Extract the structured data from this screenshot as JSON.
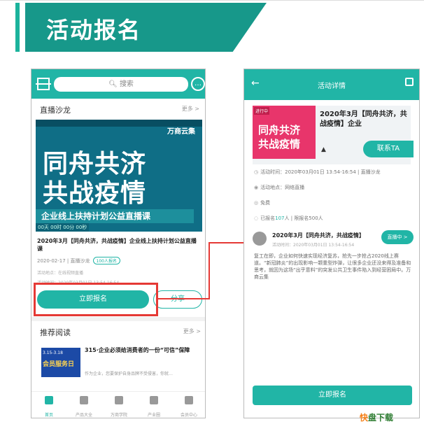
{
  "heading": "活动报名",
  "phone1": {
    "search_placeholder": "搜索",
    "section_live": {
      "title": "直播沙龙",
      "more": "更多 >"
    },
    "banner": {
      "logo": "万商云集",
      "line1": "同舟共济",
      "line2": "共战疫情",
      "tagline": "企业线上扶持计划公益直播课",
      "time": "00天 00时 00分 00秒"
    },
    "event_title": "2020年3月【同舟共济，共战疫情】企业线上扶持计划公益直播课",
    "meta_date": "2020-02-17 | 直播沙龙",
    "meta_tag": "100人报名",
    "meta_location": "活动地点：在线视频直播",
    "meta_time": "活动时间：2020年03月01日 13:54-16:54",
    "signup_label": "立即报名",
    "share_label": "分享",
    "section_reading": {
      "title": "推荐阅读",
      "more": "更多 >"
    },
    "article": {
      "thumb_top": "3.15-3.18",
      "thumb_main": "会员服务日",
      "title": "315·企业必须给消费者的一份“可信”保障",
      "sub": "作为企业，您要保护自身品牌不受侵害，你就…"
    },
    "tabs": [
      {
        "label": "首页",
        "active": true
      },
      {
        "label": "产品大全",
        "active": false
      },
      {
        "label": "万商学院",
        "active": false
      },
      {
        "label": "产业圈",
        "active": false
      },
      {
        "label": "会员中心",
        "active": false
      }
    ]
  },
  "phone2": {
    "title": "活动详情",
    "thumb_badge": "进行中",
    "thumb_line1": "同舟共济",
    "thumb_line2": "共战疫情",
    "event_title": "2020年3月【同舟共济，共战疫情】企业",
    "contact_label": "联系TA",
    "info_time": "活动时间：2020年03月01日 13:54-16:54 | 直播沙龙",
    "info_location": "活动地点：网络直播",
    "info_fee": "免费",
    "info_count_prefix": "已报名",
    "info_count_value": "107",
    "info_count_suffix": "人 | 限报名500人",
    "live": {
      "title": "2020年3月【同舟共济，共战疫情】",
      "time": "活动时间：2020年03月01日 13:54-16:54",
      "button": "直播中 >",
      "desc": "复工在即，企业如何快速实现经济复苏，抢先一步抢占2020线上赛道。“新冠肺炎”的出现影响一颗重型炸弹，让很多企业还没来得及准备和思考，就因为这场“出乎意料”的突发公共卫生事件陷入到经营困局中。万商云集"
    },
    "signup_label": "立即报名"
  },
  "watermark": {
    "a": "快",
    "b": "盘下载"
  },
  "colors": {
    "accent": "#21b5a6",
    "heading_bg": "#17988a",
    "highlight": "#e53935"
  }
}
